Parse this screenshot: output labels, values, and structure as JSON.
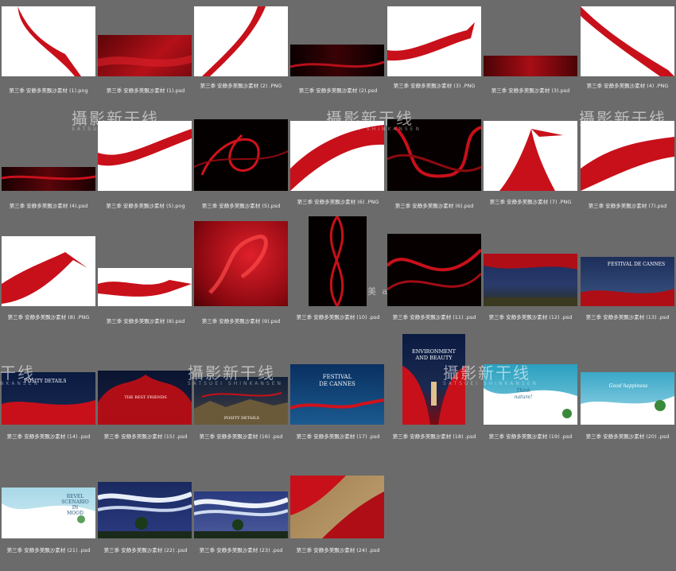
{
  "files": [
    {
      "name": "第三季 安静多美飘沙素材 (1).png",
      "thumb": "red-ribbon-white"
    },
    {
      "name": "第三季 安静多美飘沙素材 (1).psd",
      "thumb": "red-gradient"
    },
    {
      "name": "第三季 安静多美飘沙素材 (2) .PNG",
      "thumb": "red-ribbon-white"
    },
    {
      "name": "第三季 安静多美飘沙素材 (2).psd",
      "thumb": "red-dark"
    },
    {
      "name": "第三季 安静多美飘沙素材 (3) .PNG",
      "thumb": "red-ribbon-white"
    },
    {
      "name": "第三季 安静多美飘沙素材 (3).psd",
      "thumb": "red-dark"
    },
    {
      "name": "第三季 安静多美飘沙素材 (4) .PNG",
      "thumb": "red-ribbon-white"
    },
    {
      "name": "第三季 安静多美飘沙素材 (4).psd",
      "thumb": "red-dark"
    },
    {
      "name": "第三季 安静多美飘沙素材 (5).png",
      "thumb": "red-ribbon-white"
    },
    {
      "name": "第三季 安静多美飘沙素材 (5).psd",
      "thumb": "red-swirl-black"
    },
    {
      "name": "第三季 安静多美飘沙素材 (6) .PNG",
      "thumb": "red-ribbon-white"
    },
    {
      "name": "第三季 安静多美飘沙素材 (6).psd",
      "thumb": "red-swirl-black"
    },
    {
      "name": "第三季 安静多美飘沙素材 (7) .PNG",
      "thumb": "red-ribbon-white"
    },
    {
      "name": "第三季 安静多美飘沙素材 (7).psd",
      "thumb": "red-ribbon-white"
    },
    {
      "name": "第三季 安静多美飘沙素材 (8) .PNG",
      "thumb": "red-ribbon-white"
    },
    {
      "name": "第三季 安静多美飘沙素材 (8).psd",
      "thumb": "red-ribbon-white"
    },
    {
      "name": "第三季 安静多美飘沙素材 (9).psd",
      "thumb": "red-silk"
    },
    {
      "name": "第三季 安静多美飘沙素材 (10) .psd",
      "thumb": "red-swirl-black"
    },
    {
      "name": "第三季 安静多美飘沙素材 (11) .psd",
      "thumb": "red-swirl-black"
    },
    {
      "name": "第三季 安静多美飘沙素材 (12) .psd",
      "thumb": "night-landscape"
    },
    {
      "name": "第三季 安静多美飘沙素材 (13) .psd",
      "thumb": "festival-poster"
    },
    {
      "name": "第三季 安静多美飘沙素材 (14) .psd",
      "thumb": "night-red-poster"
    },
    {
      "name": "第三季 安静多美飘沙素材 (15) .psd",
      "thumb": "night-red-poster"
    },
    {
      "name": "第三季 安静多美飘沙素材 (16) .psd",
      "thumb": "rock-poster"
    },
    {
      "name": "第三季 安静多美飘沙素材 (17) .psd",
      "thumb": "festival-poster"
    },
    {
      "name": "第三季 安静多美飘沙素材 (18) .psd",
      "thumb": "environment-poster"
    },
    {
      "name": "第三季 安静多美飘沙素材 (19) .psd",
      "thumb": "white-wave-blue"
    },
    {
      "name": "第三季 安静多美飘沙素材 (20) .psd",
      "thumb": "white-wave-blue"
    },
    {
      "name": "第三季 安静多美飘沙素材 (21) .psd",
      "thumb": "white-wave-blue"
    },
    {
      "name": "第三季 安静多美飘沙素材 (22) .psd",
      "thumb": "white-wave-night"
    },
    {
      "name": "第三季 安静多美飘沙素材 (23) .psd",
      "thumb": "white-wave-night"
    },
    {
      "name": "第三季 安静多美飘沙素材 (24) .psd",
      "thumb": "red-gold"
    }
  ],
  "overlays": {
    "poster13": "FESTIVAL DE CANNES",
    "poster14": "POSITY DETAILS",
    "poster15": "THE BEST FRIENDS",
    "poster16": "POSITY DETAILS",
    "poster17_line1": "FESTIVAL",
    "poster17_line2": "DE CANNES",
    "poster18_line1": "ENVIRONMENT",
    "poster18_line2": "AND BEAUTY",
    "poster19": "Think nature!",
    "poster20": "Good happiness",
    "poster21_line1": "REVEL",
    "poster21_line2": "SCENARIO",
    "poster21_line3": "IN",
    "poster21_line4": "MOOD"
  },
  "watermarks": {
    "main": "攝影新干线",
    "sub": "SATSUEI SHINKANSEN",
    "fragment_left": "干线",
    "fragment_left_sub": "NKANSEN",
    "middle_text": "美 a"
  }
}
